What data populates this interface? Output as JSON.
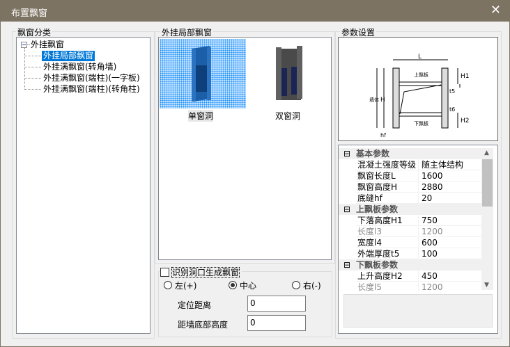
{
  "window": {
    "title": "布置飘窗",
    "close_icon": "close-icon"
  },
  "category_panel": {
    "label": "飘窗分类",
    "root": "外挂飘窗",
    "items": [
      "外挂局部飘窗",
      "外挂满飘窗(转角墙)",
      "外挂满飘窗(端柱)(一字板)",
      "外挂满飘窗(端柱)(转角柱)"
    ],
    "selected_index": 0
  },
  "style_panel": {
    "label": "外挂局部飘窗",
    "tiles": [
      {
        "label": "单窗洞",
        "selected": true
      },
      {
        "label": "双窗洞",
        "selected": false
      }
    ]
  },
  "options": {
    "checkbox_label": "识别洞口生成飘窗",
    "checked": false,
    "radios": [
      {
        "label": "左(+)",
        "checked": false
      },
      {
        "label": "中心",
        "checked": true
      },
      {
        "label": "右(-)",
        "checked": false
      }
    ],
    "fields": [
      {
        "label": "定位距离",
        "value": "0"
      },
      {
        "label": "距墙底部高度",
        "value": "0"
      }
    ]
  },
  "params_panel": {
    "label": "参数设置",
    "diagram_labels": {
      "L": "L",
      "H": "H",
      "H1": "H1",
      "H2": "H2",
      "t5": "t5",
      "t6": "t6",
      "hf": "hf",
      "top": "上飘板",
      "bottom": "下飘板",
      "wall": "墙体"
    },
    "categories": [
      {
        "name": "基本参数",
        "rows": [
          {
            "k": "混凝土强度等级",
            "v": "随主体结构"
          },
          {
            "k": "飘窗长度L",
            "v": "1600"
          },
          {
            "k": "飘窗高度H",
            "v": "2880"
          },
          {
            "k": "底缝hf",
            "v": "20"
          }
        ]
      },
      {
        "name": "上飘板参数",
        "rows": [
          {
            "k": "下落高度H1",
            "v": "750"
          },
          {
            "k": "长度l3",
            "v": "1200",
            "disabled": true
          },
          {
            "k": "宽度l4",
            "v": "600"
          },
          {
            "k": "外端厚度t5",
            "v": "100"
          }
        ]
      },
      {
        "name": "下飘板参数",
        "rows": [
          {
            "k": "上升高度H2",
            "v": "450"
          },
          {
            "k": "长度l5",
            "v": "1200",
            "disabled": true
          }
        ]
      }
    ]
  }
}
